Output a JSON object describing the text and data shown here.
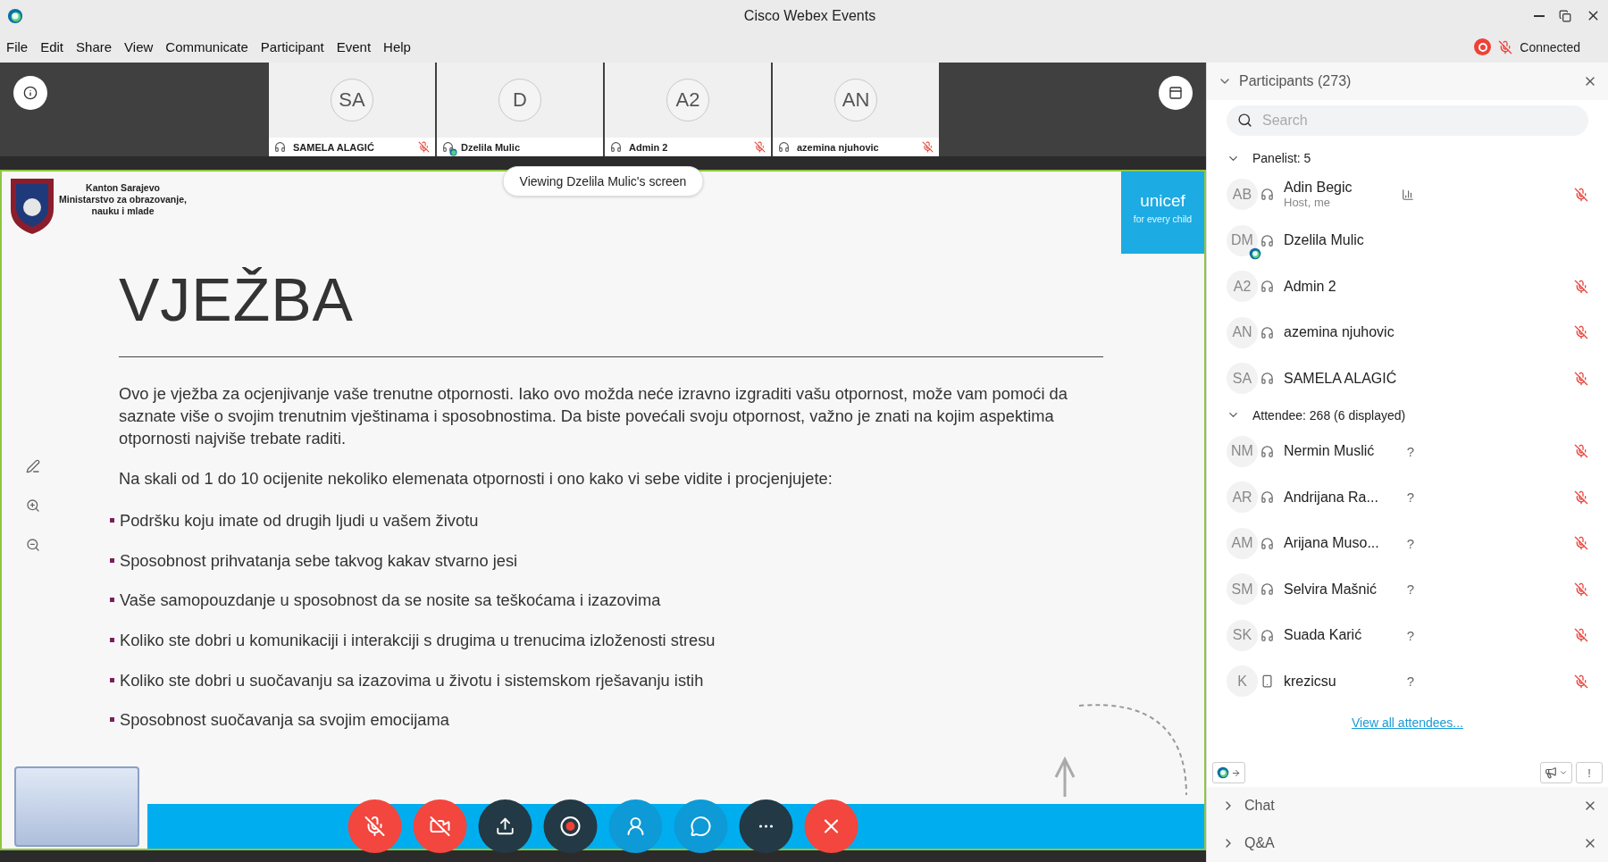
{
  "window": {
    "title": "Cisco Webex Events"
  },
  "menu": [
    "File",
    "Edit",
    "Share",
    "View",
    "Communicate",
    "Participant",
    "Event",
    "Help"
  ],
  "status": {
    "label": "Connected",
    "recording": true,
    "muted": true
  },
  "video_strip": {
    "thumbnails": [
      {
        "initials": "SA",
        "name": "SAMELA ALAGIĆ",
        "presenter": false,
        "muted": true
      },
      {
        "initials": "D",
        "name": "Dzelila Mulic",
        "presenter": true,
        "muted": false
      },
      {
        "initials": "A2",
        "name": "Admin 2",
        "presenter": false,
        "muted": true
      },
      {
        "initials": "AN",
        "name": "azemina njuhovic",
        "presenter": false,
        "muted": true
      }
    ]
  },
  "slide": {
    "banner": "Viewing Dzelila Mulic's screen",
    "org_lines": [
      "Kanton Sarajevo",
      "Ministarstvo za obrazovanje,",
      "nauku i mlade"
    ],
    "logo": {
      "name": "unicef",
      "tagline": "for every child"
    },
    "title": "VJEŽBA",
    "paragraphs": [
      "Ovo je vježba za ocjenjivanje vaše trenutne otpornosti. Iako ovo možda neće izravno izgraditi vašu otpornost, može vam pomoći da saznate više o svojim trenutnim vještinama i sposobnostima. Da biste povećali svoju otpornost, važno je znati na kojim aspektima otpornosti najviše trebate raditi.",
      "Na skali od 1 do 10 ocijenite nekoliko elemenata otpornosti i ono kako vi sebe vidite i procjenjujete:"
    ],
    "bullets": [
      "Podršku koju imate od drugih ljudi u vašem životu",
      "Sposobnost prihvatanja sebe takvog kakav stvarno jesi",
      "Vaše samopouzdanje u sposobnost da se nosite sa teškoćama i izazovima",
      "Koliko ste dobri u komunikaciji i interakciji s drugima u trenucima izloženosti stresu",
      "Koliko ste dobri u suočavanju sa izazovima u životu i  sistemskom rješavanju istih",
      "Sposobnost suočavanja sa svojim emocijama"
    ]
  },
  "toolbar": [
    {
      "kind": "mute",
      "color": "#f2463e"
    },
    {
      "kind": "video-off",
      "color": "#f2463e"
    },
    {
      "kind": "share",
      "color": "#233945"
    },
    {
      "kind": "record",
      "color": "#233945"
    },
    {
      "kind": "participants",
      "color": "#0d9ad6"
    },
    {
      "kind": "chat",
      "color": "#0d9ad6"
    },
    {
      "kind": "more",
      "color": "#233945"
    },
    {
      "kind": "leave",
      "color": "#f2463e"
    }
  ],
  "participants": {
    "title": "Participants (273)",
    "search": {
      "placeholder": "Search"
    },
    "groups": [
      {
        "label": "Panelist: 5",
        "expanded": true,
        "members": [
          {
            "initials": "AB",
            "name": "Adin Begic",
            "subtitle": "Host, me",
            "kind": "headset",
            "presenter": false,
            "signal": true,
            "muted": true
          },
          {
            "initials": "DM",
            "name": "Dzelila Mulic",
            "kind": "headset",
            "presenter": true,
            "signal": false,
            "muted": false
          },
          {
            "initials": "A2",
            "name": "Admin 2",
            "kind": "headset",
            "presenter": false,
            "signal": false,
            "muted": true
          },
          {
            "initials": "AN",
            "name": "azemina njuhovic",
            "kind": "headset",
            "presenter": false,
            "signal": false,
            "muted": true
          },
          {
            "initials": "SA",
            "name": "SAMELA ALAGIĆ",
            "kind": "headset",
            "presenter": false,
            "signal": false,
            "muted": true
          }
        ]
      },
      {
        "label": "Attendee: 268 (6 displayed)",
        "expanded": true,
        "members": [
          {
            "initials": "NM",
            "name": "Nermin Muslić",
            "kind": "headset",
            "presenter": false,
            "signal": false,
            "muted": true,
            "status": "?"
          },
          {
            "initials": "AR",
            "name": "Andrijana Ra...",
            "kind": "headset",
            "presenter": false,
            "signal": false,
            "muted": true,
            "status": "?"
          },
          {
            "initials": "AM",
            "name": "Arijana Muso...",
            "kind": "headset",
            "presenter": false,
            "signal": false,
            "muted": true,
            "status": "?"
          },
          {
            "initials": "SM",
            "name": "Selvira Mašnić",
            "kind": "headset",
            "presenter": false,
            "signal": false,
            "muted": true,
            "status": "?"
          },
          {
            "initials": "SK",
            "name": "Suada Karić",
            "kind": "headset",
            "presenter": false,
            "signal": false,
            "muted": true,
            "status": "?"
          },
          {
            "initials": "K",
            "name": "krezicsu",
            "kind": "phone",
            "presenter": false,
            "signal": false,
            "muted": true,
            "status": "?"
          }
        ]
      }
    ],
    "link": "View all attendees...",
    "alert_label": "!"
  },
  "sections": [
    {
      "label": "Chat",
      "expanded": false
    },
    {
      "label": "Q&A",
      "expanded": false
    }
  ]
}
